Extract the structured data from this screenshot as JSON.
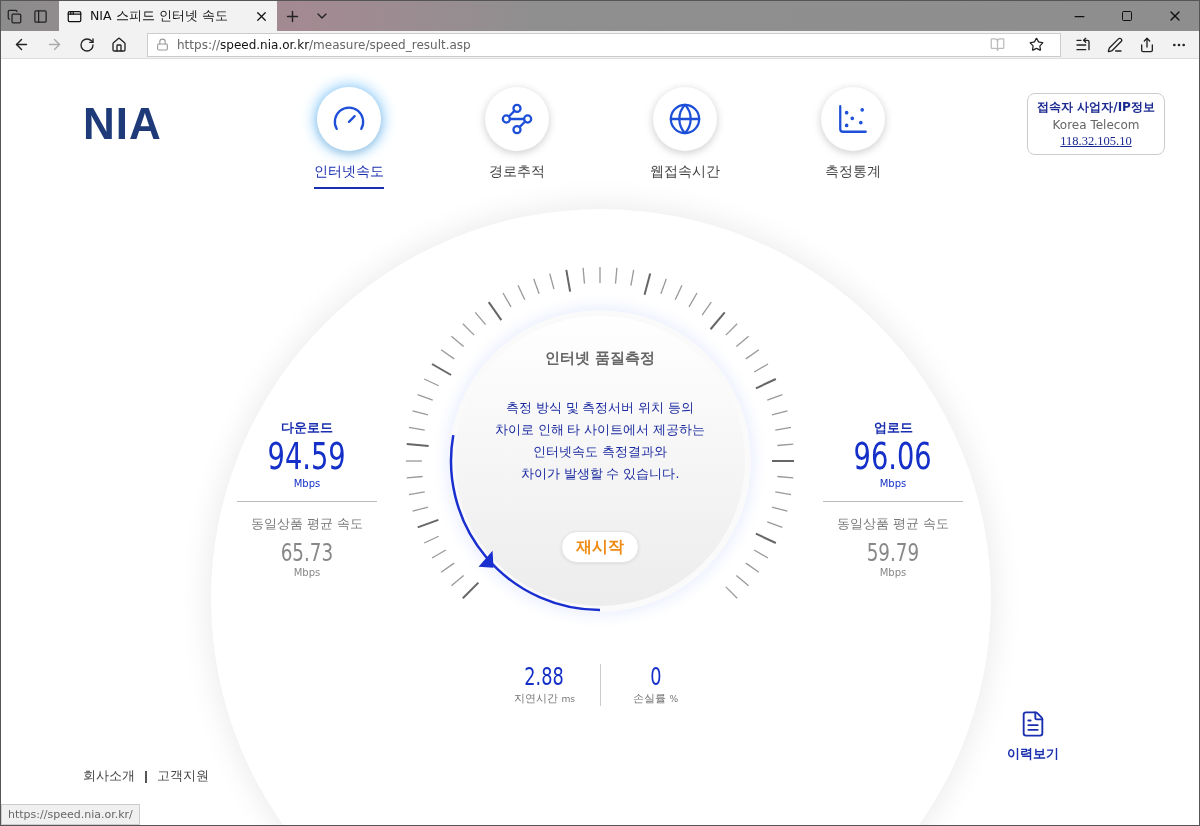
{
  "browser": {
    "tab_title": "NIA 스피드 인터넷 속도",
    "url": {
      "scheme": "https://",
      "host": "speed.nia.or.kr",
      "path": "/measure/speed_result.asp"
    },
    "status_url": "https://speed.nia.or.kr/"
  },
  "logo": "NIA",
  "nav": [
    {
      "label": "인터넷속도",
      "selected": true
    },
    {
      "label": "경로추적",
      "selected": false
    },
    {
      "label": "웹접속시간",
      "selected": false
    },
    {
      "label": "측정통계",
      "selected": false
    }
  ],
  "connection_info": {
    "title": "접속자 사업자/IP정보",
    "isp": "Korea Telecom",
    "ip": "118.32.105.10"
  },
  "download": {
    "label": "다운로드",
    "value": "94.59",
    "unit": "Mbps",
    "avg_label": "동일상품 평균 속도",
    "avg_value": "65.73",
    "avg_unit": "Mbps"
  },
  "upload": {
    "label": "업로드",
    "value": "96.06",
    "unit": "Mbps",
    "avg_label": "동일상품 평균 속도",
    "avg_value": "59.79",
    "avg_unit": "Mbps"
  },
  "gauge": {
    "title": "인터넷 품질측정",
    "notice": [
      "측정 방식 및 측정서버 위치 등의",
      "차이로 인해 타 사이트에서 제공하는",
      "인터넷속도 측정결과와",
      "차이가 발생할 수 있습니다."
    ],
    "restart": "재시작"
  },
  "metrics": [
    {
      "value": "2.88",
      "label": "지연시간",
      "unit": "ms"
    },
    {
      "value": "0",
      "label": "손실률",
      "unit": "%"
    }
  ],
  "history": "이력보기",
  "footer": [
    "회사소개",
    "고객지원"
  ]
}
